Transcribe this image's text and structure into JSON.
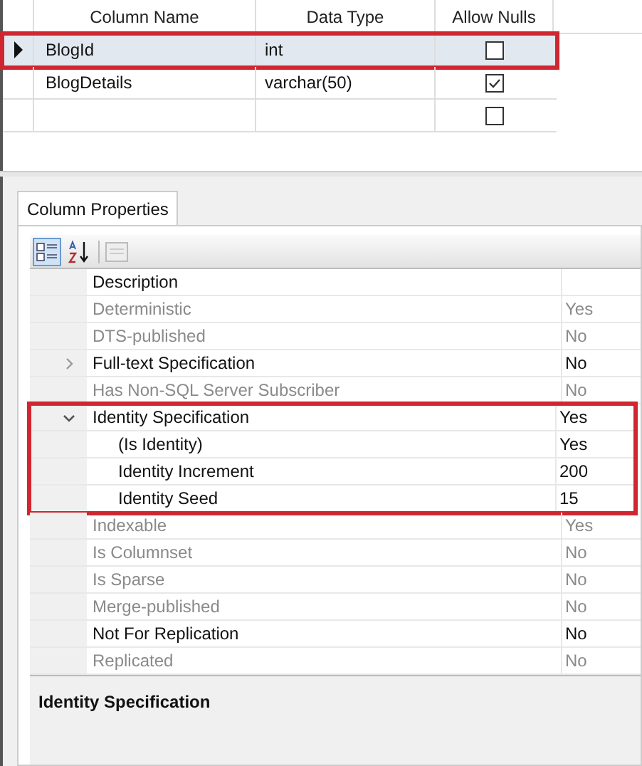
{
  "grid": {
    "columns": [
      "Column Name",
      "Data Type",
      "Allow Nulls"
    ],
    "rows": [
      {
        "name": "BlogId",
        "type": "int",
        "allow_nulls": false,
        "selected": true,
        "highlighted": true
      },
      {
        "name": "BlogDetails",
        "type": "varchar(50)",
        "allow_nulls": true,
        "selected": false,
        "highlighted": false
      },
      {
        "name": "",
        "type": "",
        "allow_nulls": false,
        "selected": false,
        "highlighted": false
      }
    ]
  },
  "tab": {
    "label": "Column Properties"
  },
  "properties": [
    {
      "name": "Description",
      "disabled": false
    },
    {
      "name": "Deterministic",
      "value": "Yes",
      "disabled": true
    },
    {
      "name": "DTS-published",
      "value": "No",
      "disabled": true
    },
    {
      "name": "Full-text Specification",
      "value": "No",
      "disabled": false,
      "expanded": false
    },
    {
      "name": "Has Non-SQL Server Subscriber",
      "value": "No",
      "disabled": true
    },
    {
      "name": "Identity Specification",
      "value": "Yes",
      "disabled": false,
      "expanded": true,
      "highlighted": true,
      "children": [
        {
          "name": "(Is Identity)",
          "value": "Yes",
          "disabled": false
        },
        {
          "name": "Identity Increment",
          "value": "200",
          "disabled": false
        },
        {
          "name": "Identity Seed",
          "value": "15",
          "disabled": false
        }
      ]
    },
    {
      "name": "Indexable",
      "value": "Yes",
      "disabled": true
    },
    {
      "name": "Is Columnset",
      "value": "No",
      "disabled": true
    },
    {
      "name": "Is Sparse",
      "value": "No",
      "disabled": true
    },
    {
      "name": "Merge-published",
      "value": "No",
      "disabled": true
    },
    {
      "name": "Not For Replication",
      "value": "No",
      "disabled": false
    },
    {
      "name": "Replicated",
      "value": "No",
      "disabled": true
    }
  ],
  "description": {
    "title": "Identity Specification"
  }
}
